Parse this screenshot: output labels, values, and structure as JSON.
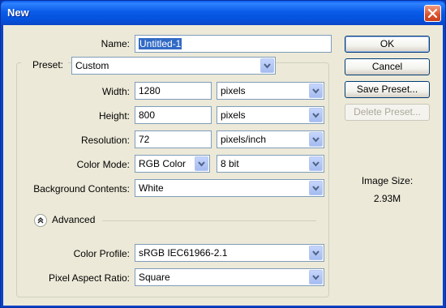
{
  "window": {
    "title": "New"
  },
  "name": {
    "label": "Name:",
    "value": "Untitled-1"
  },
  "preset": {
    "label": "Preset:",
    "value": "Custom"
  },
  "width": {
    "label": "Width:",
    "value": "1280",
    "unit": "pixels"
  },
  "height": {
    "label": "Height:",
    "value": "800",
    "unit": "pixels"
  },
  "resolution": {
    "label": "Resolution:",
    "value": "72",
    "unit": "pixels/inch"
  },
  "color_mode": {
    "label": "Color Mode:",
    "value": "RGB Color",
    "depth": "8 bit"
  },
  "background": {
    "label": "Background Contents:",
    "value": "White"
  },
  "advanced": {
    "label": "Advanced"
  },
  "color_profile": {
    "label": "Color Profile:",
    "value": "sRGB IEC61966-2.1"
  },
  "pixel_aspect": {
    "label": "Pixel Aspect Ratio:",
    "value": "Square"
  },
  "buttons": {
    "ok": "OK",
    "cancel": "Cancel",
    "save_preset": "Save Preset...",
    "delete_preset": "Delete Preset..."
  },
  "image_size": {
    "label": "Image Size:",
    "value": "2.93M"
  },
  "colors": {
    "title_bar": "#0a5ce8",
    "selection": "#316ac5",
    "close": "#d9512b"
  }
}
